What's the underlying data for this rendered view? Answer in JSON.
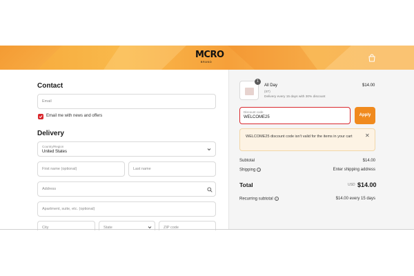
{
  "header": {
    "logo_main": "MCRO",
    "logo_sub": "BRAND",
    "cart_icon": "shopping-bag-icon",
    "colors": {
      "banner": "#f7a83a"
    }
  },
  "contact": {
    "title": "Contact",
    "email_placeholder": "Email",
    "newsletter_label": "Email me with news and offers",
    "newsletter_checked": true
  },
  "delivery": {
    "title": "Delivery",
    "country_label": "Country/Region",
    "country_value": "United States",
    "first_name_placeholder": "First name (optional)",
    "last_name_placeholder": "Last name",
    "address_placeholder": "Address",
    "apartment_placeholder": "Apartment, suite, etc. (optional)",
    "city_placeholder": "City",
    "state_placeholder": "State",
    "zip_placeholder": "ZIP code"
  },
  "summary": {
    "item": {
      "quantity": "1",
      "name": "All Day",
      "variant": "(ST)",
      "plan": "Delivery every 15 days with 30% discount",
      "price": "$14.00"
    },
    "discount": {
      "label": "Discount code",
      "value": "WELCOME25",
      "apply_label": "Apply"
    },
    "alert": {
      "message": "WELCOME25 discount code isn't valid for the items in your cart",
      "close": "✕"
    },
    "subtotal_label": "Subtotal",
    "subtotal_value": "$14.00",
    "shipping_label": "Shipping",
    "shipping_value": "Enter shipping address",
    "total_label": "Total",
    "total_currency": "USD",
    "total_value": "$14.00",
    "recurring_label": "Recurring subtotal",
    "recurring_value": "$14.00 every 15 days",
    "colors": {
      "error": "#d9262c",
      "apply": "#f08a1e",
      "alert_bg": "#fdf3e4"
    }
  }
}
